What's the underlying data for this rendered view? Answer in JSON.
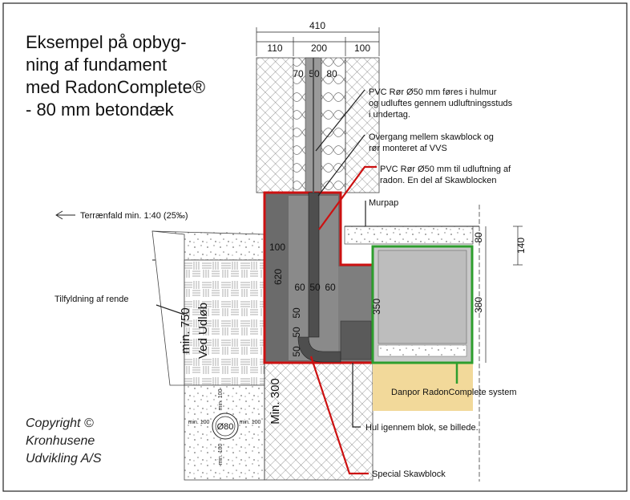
{
  "title": {
    "lines": [
      "Eksempel på opbyg-",
      "ning af fundament",
      "med RadonComplete®",
      "- 80 mm betondæk"
    ]
  },
  "copyright": {
    "lines": [
      "Copyright ©",
      "Kronhusene",
      "Udvikling A/S"
    ]
  },
  "dimensions": {
    "top_total": "410",
    "top_parts": [
      "110",
      "200",
      "100"
    ],
    "insulation_parts": [
      "70",
      "50",
      "80"
    ],
    "block_mid": [
      "60",
      "50",
      "60"
    ],
    "block_bottom": [
      "50",
      "50",
      "50"
    ],
    "block_side": "100",
    "block_height": "620",
    "h350": "350",
    "h380": "380",
    "h80": "80",
    "h140": "140",
    "min300": "Min. 300",
    "min750": "min. 750",
    "ved_udlob": "Ved Udløb",
    "drain_diameter": "Ø80",
    "min100_a": "min. 100",
    "min100_b": "min. 100",
    "min100_c": "min. 100",
    "min100_d": "min. 100"
  },
  "annotations": {
    "pvc1": [
      "PVC Rør Ø50 mm føres i hulmur",
      "og udluftes gennem udluftningsstuds",
      "i undertag."
    ],
    "overgang": [
      "Overgang mellem skawblock og",
      "rør monteret af VVS"
    ],
    "pvc2": [
      "PVC Rør Ø50 mm til udluftning af",
      "radon. En del af Skawblocken"
    ],
    "murpap": "Murpap",
    "terraen": "Terrænfald min. 1:40 (25‰)",
    "tilfyldning": "Tilfyldning af rende",
    "danpor": "Danpor RadonComplete system",
    "hul": "Hul igennem blok, se billede.",
    "special": "Special Skawblock"
  },
  "colors": {
    "red": "#cc1111",
    "green": "#2e9e2e",
    "block_dark": "#6b6b6b",
    "sand": "#f2d99a"
  }
}
